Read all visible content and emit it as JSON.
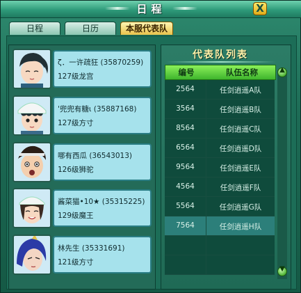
{
  "window": {
    "title": "日程",
    "close_label": "X"
  },
  "tabs": [
    {
      "label": "日程",
      "active": false
    },
    {
      "label": "日历",
      "active": false
    },
    {
      "label": "本服代表队",
      "active": true
    }
  ],
  "members": [
    {
      "name_line": "ζ．一许疏狂 (35870259)",
      "detail_line": "127级龙宫",
      "avatar": "ponytail-boy-avatar"
    },
    {
      "name_line": "'兜兜有糖ι (35887168)",
      "detail_line": "127级方寸",
      "avatar": "white-hat-boy-avatar"
    },
    {
      "name_line": "哪有西瓜 (36543013)",
      "detail_line": "126级狮驼",
      "avatar": "surprised-boy-avatar"
    },
    {
      "name_line": "酱菜猫•10★ (35315225)",
      "detail_line": "129级魔王",
      "avatar": "smiling-girl-avatar"
    },
    {
      "name_line": "林先生 (35331691)",
      "detail_line": "121级方寸",
      "avatar": "blue-hair-avatar"
    }
  ],
  "team_list": {
    "title": "代表队列表",
    "headers": {
      "number": "编号",
      "team_name": "队伍名称"
    },
    "rows": [
      {
        "number": "2564",
        "team_name": "任剑逍遥A队"
      },
      {
        "number": "3564",
        "team_name": "任剑逍遥B队"
      },
      {
        "number": "8564",
        "team_name": "任剑逍遥C队"
      },
      {
        "number": "6564",
        "team_name": "任剑逍遥D队"
      },
      {
        "number": "9564",
        "team_name": "任剑逍遥E队"
      },
      {
        "number": "4564",
        "team_name": "任剑逍遥F队"
      },
      {
        "number": "5564",
        "team_name": "任剑逍遥G队"
      },
      {
        "number": "7564",
        "team_name": "任剑逍遥H队",
        "selected": true
      },
      {
        "number": "",
        "team_name": ""
      },
      {
        "number": "",
        "team_name": ""
      }
    ]
  },
  "colors": {
    "frame_green": "#1d6b55",
    "tab_active": "#e9c24b",
    "header_green": "#3fb52d",
    "row_highlight": "#2c7f7a",
    "list_title": "#fff0a8"
  },
  "icons": {
    "close": "close-icon",
    "scroll_up": "chevron-up-icon",
    "scroll_down": "chevron-down-icon"
  }
}
